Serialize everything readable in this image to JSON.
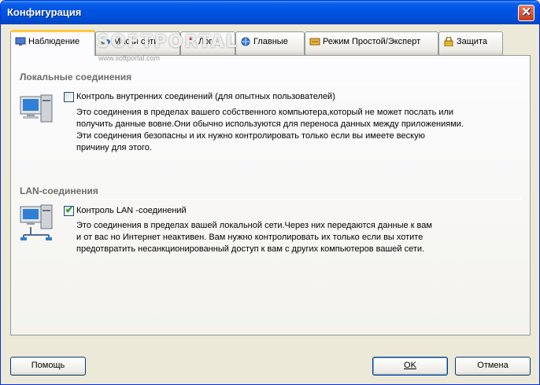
{
  "window": {
    "title": "Конфигурация"
  },
  "tabs": [
    {
      "label": "Наблюдение",
      "icon": "monitor-icon",
      "active": true
    },
    {
      "label": "Маски сети",
      "icon": "network-mask-icon",
      "active": false
    },
    {
      "label": "Лог",
      "icon": "log-icon",
      "active": false
    },
    {
      "label": "Главные",
      "icon": "globe-icon",
      "active": false
    },
    {
      "label": "Режим Простой/Эксперт",
      "icon": "mode-icon",
      "active": false
    },
    {
      "label": "Защита",
      "icon": "lock-icon",
      "active": false
    }
  ],
  "watermark": {
    "brand": "SOFTPORTAL",
    "url": "www.softportal.com"
  },
  "local": {
    "title": "Локальные соединения",
    "checkbox_label": "Контроль внутренних соединений (для опытных пользователей)",
    "checked": false,
    "desc": [
      "Это соединения в пределах вашего собственного компьютера,который не может послать или",
      "получить данные вовне.Они обычно используются для переноса данных между приложениями.",
      "Эти соединения безопасны и их нужно контролировать только если вы имеете вескую",
      "причину для этого."
    ]
  },
  "lan": {
    "title": "LAN-соединения",
    "checkbox_label": "Контроль LAN -соединений",
    "checked": true,
    "desc": [
      "Это соединения в пределах вашей локальной сети.Через них передаются данные к вам",
      "и от вас но Интернет неактивен. Вам нужно контролировать их только если вы хотите",
      "предотвратить несанкционированный доступ  к вам с других компьютеров вашей сети."
    ]
  },
  "buttons": {
    "help": "Помощь",
    "ok": "OK",
    "cancel": "Отмена"
  }
}
